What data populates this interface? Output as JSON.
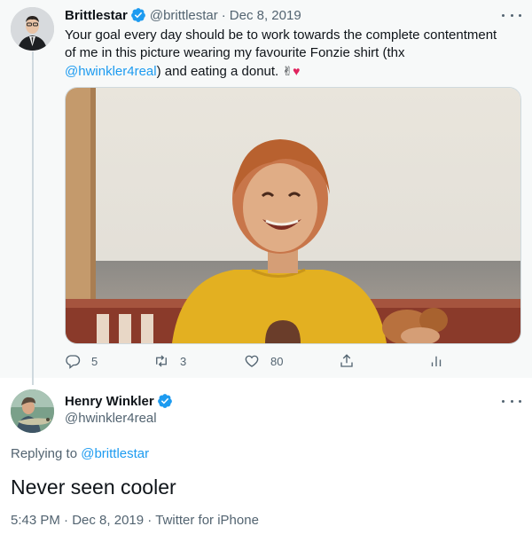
{
  "tweet": {
    "author_name": "Brittlestar",
    "handle": "@brittlestar",
    "separator": "·",
    "date": "Dec 8, 2019",
    "text_part1": "Your goal every day should be to work towards the complete contentment of me in this picture wearing my favourite Fonzie shirt (thx ",
    "mention": "@hwinkler4real",
    "text_part2": ") and eating a donut. ",
    "emoji_victory": "✌",
    "emoji_heart": "♥",
    "actions": {
      "reply_count": "5",
      "retweet_count": "3",
      "like_count": "80"
    }
  },
  "reply": {
    "author_name": "Henry Winkler",
    "handle": "@hwinkler4real",
    "replying_prefix": "Replying to ",
    "replying_to": "@brittlestar",
    "text": "Never seen cooler",
    "time": "5:43 PM",
    "separator": "·",
    "date": "Dec 8, 2019",
    "source": "Twitter for iPhone"
  },
  "colors": {
    "accent": "#1d9bf0",
    "heart": "#e0245e",
    "muted": "#536471"
  },
  "icons": [
    "verified-icon",
    "more-icon",
    "reply-icon",
    "retweet-icon",
    "like-icon",
    "share-icon",
    "analytics-icon"
  ]
}
